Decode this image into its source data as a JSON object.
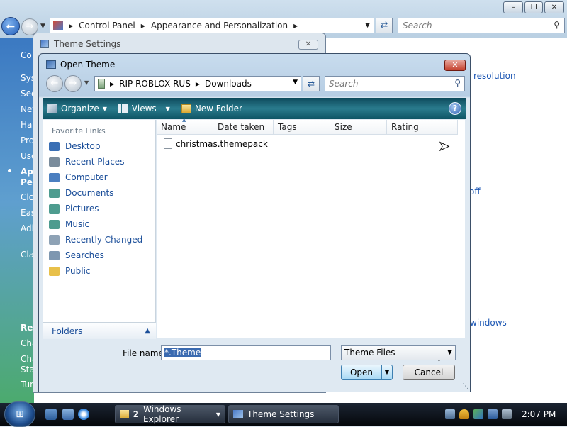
{
  "explorer": {
    "address_parts": [
      "Control Panel",
      "Appearance and Personalization"
    ],
    "search_placeholder": "Search",
    "side_fragments": [
      "Co",
      "Sys",
      "Sec",
      "Net",
      "Hai",
      "Pro",
      "Use",
      "App",
      "Per",
      "Clo",
      "Eas",
      "Adi",
      "Cla",
      "Re",
      "Cha",
      "Cha",
      "Start",
      "Tur"
    ],
    "right_links": [
      "resolution",
      "off",
      "windows"
    ],
    "window_buttons": [
      "–",
      "❐",
      "✕"
    ]
  },
  "theme_settings": {
    "title": "Theme Settings",
    "close_label": "✕"
  },
  "open_theme": {
    "title": "Open Theme",
    "close_label": "✕",
    "address_parts": [
      "RIP ROBLOX RUS",
      "Downloads"
    ],
    "search_placeholder": "Search",
    "toolbar": {
      "organize": "Organize",
      "views": "Views",
      "new_folder": "New Folder",
      "help": "?"
    },
    "favorite_links_heading": "Favorite Links",
    "favorite_links": [
      {
        "label": "Desktop",
        "icon": "desktop-icon",
        "color": "#3a6fb5"
      },
      {
        "label": "Recent Places",
        "icon": "recent-places-icon",
        "color": "#7a8c9c"
      },
      {
        "label": "Computer",
        "icon": "computer-icon",
        "color": "#4b7fc0"
      },
      {
        "label": "Documents",
        "icon": "documents-icon",
        "color": "#4e9c8f"
      },
      {
        "label": "Pictures",
        "icon": "pictures-icon",
        "color": "#4e9c8f"
      },
      {
        "label": "Music",
        "icon": "music-icon",
        "color": "#4e9c8f"
      },
      {
        "label": "Recently Changed",
        "icon": "recently-changed-icon",
        "color": "#8ea2b5"
      },
      {
        "label": "Searches",
        "icon": "searches-icon",
        "color": "#7e97b0"
      },
      {
        "label": "Public",
        "icon": "public-folder-icon",
        "color": "#e8c04a"
      }
    ],
    "folders_label": "Folders",
    "columns": [
      "Name",
      "Date taken",
      "Tags",
      "Size",
      "Rating"
    ],
    "files": [
      "christmas.themepack"
    ],
    "file_name_label": "File name:",
    "file_name_value": "*.Theme",
    "file_type_value": "Theme Files",
    "open_button": "Open",
    "cancel_button": "Cancel"
  },
  "taskbar": {
    "start_label": "⊞",
    "tasks": [
      {
        "count": "2",
        "label": "Windows Explorer"
      },
      {
        "label": "Theme Settings"
      }
    ],
    "clock": "2:07 PM"
  },
  "colors": {
    "link_blue": "#1b4e99",
    "toolbar_teal": "#1d6a7b",
    "accent_selection": "#3a6ab0"
  }
}
